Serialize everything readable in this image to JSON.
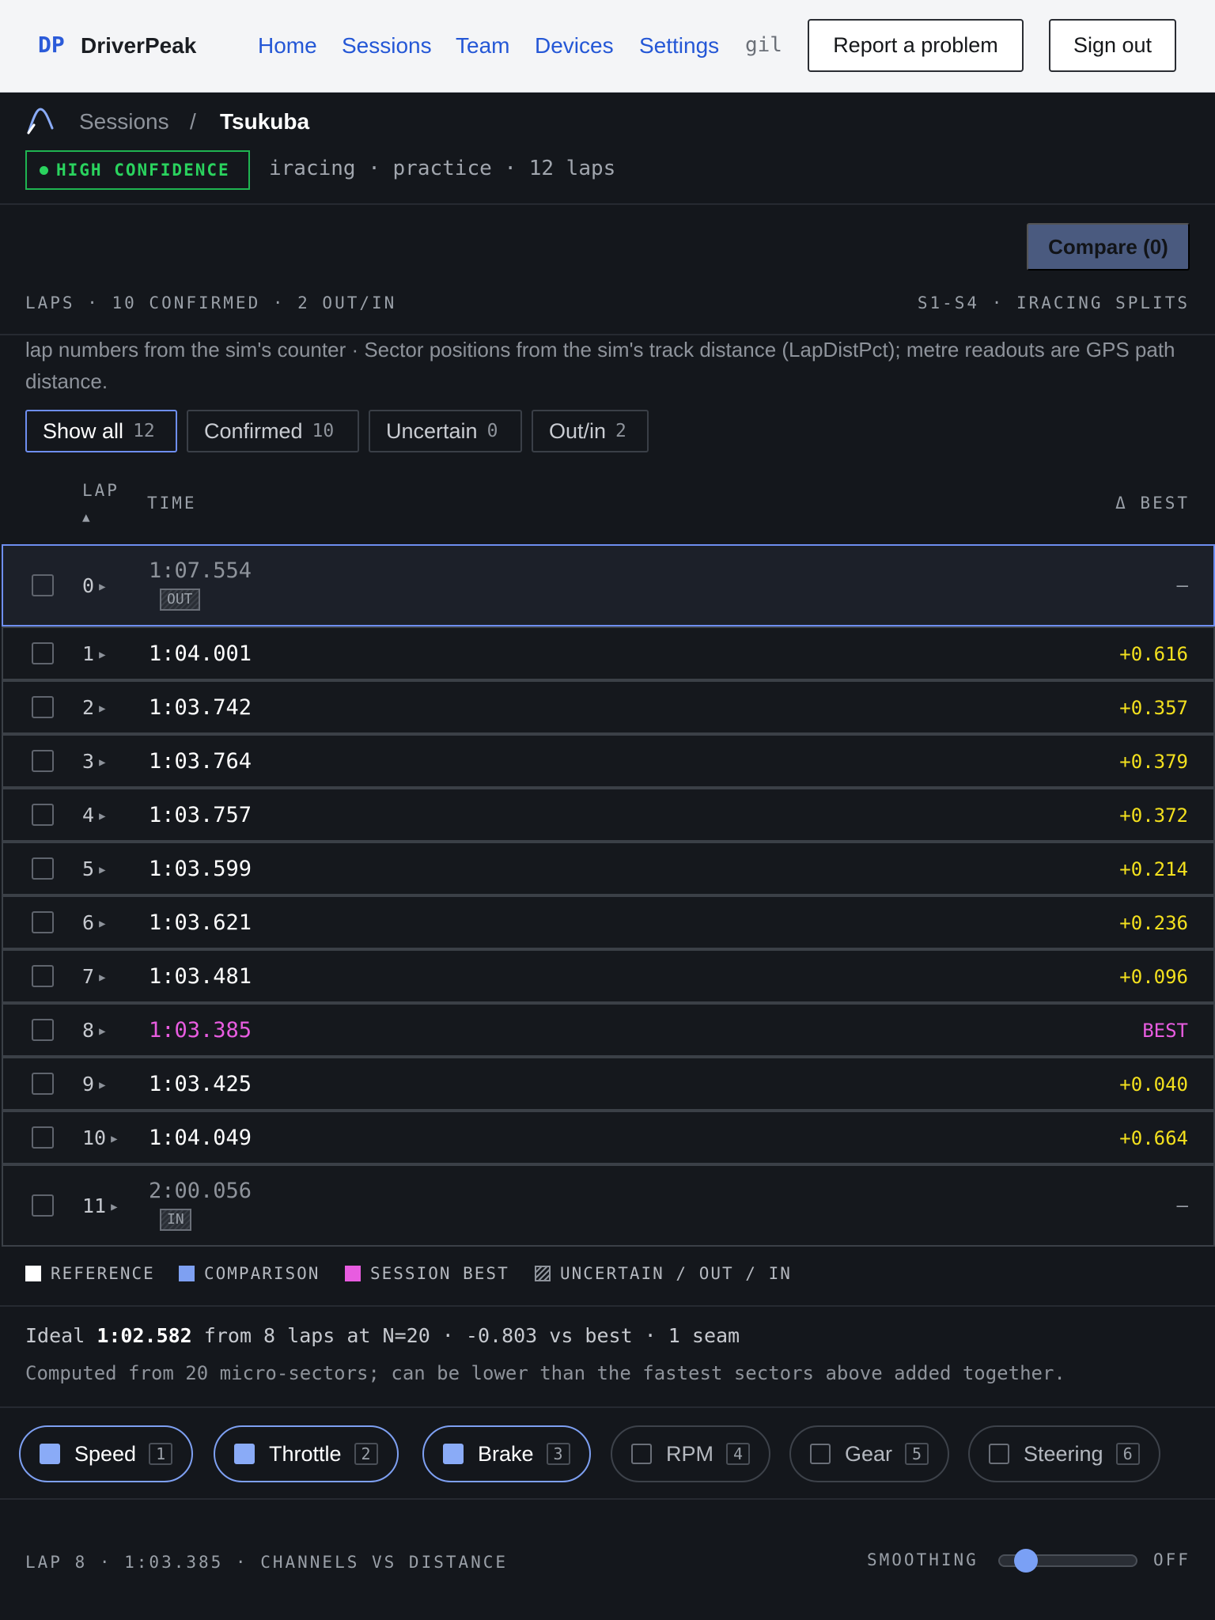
{
  "nav": {
    "brand_mark": "DP",
    "brand_name": "DriverPeak",
    "links": [
      "Home",
      "Sessions",
      "Team",
      "Devices",
      "Settings"
    ],
    "user": "gil",
    "report_label": "Report a problem",
    "signout_label": "Sign out"
  },
  "header": {
    "crumb_root": "Sessions",
    "crumb_sep": "/",
    "crumb_current": "Tsukuba",
    "confidence": "HIGH CONFIDENCE",
    "meta": "iracing · practice · 12 laps"
  },
  "toolbar": {
    "compare_label": "Compare (0)"
  },
  "laps_section": {
    "left_label": "LAPS · 10 CONFIRMED · 2 OUT/IN",
    "right_label": "S1-S4 · IRACING SPLITS",
    "note": "lap numbers from the sim's counter · Sector positions from the sim's track distance (LapDistPct); metre readouts are GPS path distance."
  },
  "filters": [
    {
      "label": "Show all",
      "count": "12",
      "active": true
    },
    {
      "label": "Confirmed",
      "count": "10",
      "active": false
    },
    {
      "label": "Uncertain",
      "count": "0",
      "active": false
    },
    {
      "label": "Out/in",
      "count": "2",
      "active": false
    }
  ],
  "table": {
    "col_lap": "LAP",
    "sort_icon": "▲",
    "col_time": "TIME",
    "col_delta": "Δ BEST",
    "rows": [
      {
        "lap": "0",
        "time": "1:07.554",
        "tag": "OUT",
        "delta": "—",
        "kind": "out",
        "selected": true
      },
      {
        "lap": "1",
        "time": "1:04.001",
        "delta": "+0.616",
        "kind": "normal"
      },
      {
        "lap": "2",
        "time": "1:03.742",
        "delta": "+0.357",
        "kind": "normal"
      },
      {
        "lap": "3",
        "time": "1:03.764",
        "delta": "+0.379",
        "kind": "normal"
      },
      {
        "lap": "4",
        "time": "1:03.757",
        "delta": "+0.372",
        "kind": "normal"
      },
      {
        "lap": "5",
        "time": "1:03.599",
        "delta": "+0.214",
        "kind": "normal"
      },
      {
        "lap": "6",
        "time": "1:03.621",
        "delta": "+0.236",
        "kind": "normal"
      },
      {
        "lap": "7",
        "time": "1:03.481",
        "delta": "+0.096",
        "kind": "normal"
      },
      {
        "lap": "8",
        "time": "1:03.385",
        "delta": "BEST",
        "kind": "best"
      },
      {
        "lap": "9",
        "time": "1:03.425",
        "delta": "+0.040",
        "kind": "normal"
      },
      {
        "lap": "10",
        "time": "1:04.049",
        "delta": "+0.664",
        "kind": "normal"
      },
      {
        "lap": "11",
        "time": "2:00.056",
        "tag": "IN",
        "delta": "—",
        "kind": "in"
      }
    ]
  },
  "legend": [
    {
      "label": "REFERENCE",
      "color": "#ffffff"
    },
    {
      "label": "COMPARISON",
      "color": "#7ea0f2"
    },
    {
      "label": "SESSION BEST",
      "color": "#e85ce0"
    },
    {
      "label": "UNCERTAIN / OUT / IN",
      "color": "hatched"
    }
  ],
  "ideal": {
    "prefix": "Ideal ",
    "time": "1:02.582",
    "suffix": " from 8 laps at N=20 · -0.803 vs best · 1 seam",
    "sub": "Computed from 20 micro-sectors; can be lower than the fastest sectors above added together."
  },
  "channels": [
    {
      "label": "Speed",
      "key": "1",
      "on": true
    },
    {
      "label": "Throttle",
      "key": "2",
      "on": true
    },
    {
      "label": "Brake",
      "key": "3",
      "on": true
    },
    {
      "label": "RPM",
      "key": "4",
      "on": false
    },
    {
      "label": "Gear",
      "key": "5",
      "on": false
    },
    {
      "label": "Steering",
      "key": "6",
      "on": false
    }
  ],
  "plot": {
    "title": "LAP 8 · 1:03.385 · CHANNELS VS DISTANCE",
    "smoothing_label": "SMOOTHING",
    "smoothing_value": "OFF",
    "smoothing_level": 0
  }
}
